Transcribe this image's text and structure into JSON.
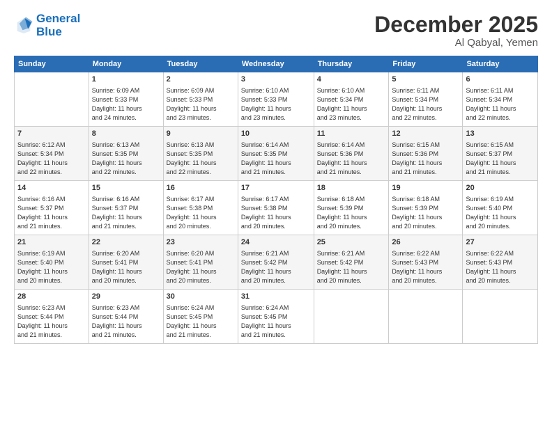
{
  "logo": {
    "line1": "General",
    "line2": "Blue"
  },
  "title": "December 2025",
  "subtitle": "Al Qabyal, Yemen",
  "header_days": [
    "Sunday",
    "Monday",
    "Tuesday",
    "Wednesday",
    "Thursday",
    "Friday",
    "Saturday"
  ],
  "weeks": [
    [
      {
        "day": "",
        "info": ""
      },
      {
        "day": "1",
        "info": "Sunrise: 6:09 AM\nSunset: 5:33 PM\nDaylight: 11 hours\nand 24 minutes."
      },
      {
        "day": "2",
        "info": "Sunrise: 6:09 AM\nSunset: 5:33 PM\nDaylight: 11 hours\nand 23 minutes."
      },
      {
        "day": "3",
        "info": "Sunrise: 6:10 AM\nSunset: 5:33 PM\nDaylight: 11 hours\nand 23 minutes."
      },
      {
        "day": "4",
        "info": "Sunrise: 6:10 AM\nSunset: 5:34 PM\nDaylight: 11 hours\nand 23 minutes."
      },
      {
        "day": "5",
        "info": "Sunrise: 6:11 AM\nSunset: 5:34 PM\nDaylight: 11 hours\nand 22 minutes."
      },
      {
        "day": "6",
        "info": "Sunrise: 6:11 AM\nSunset: 5:34 PM\nDaylight: 11 hours\nand 22 minutes."
      }
    ],
    [
      {
        "day": "7",
        "info": "Sunrise: 6:12 AM\nSunset: 5:34 PM\nDaylight: 11 hours\nand 22 minutes."
      },
      {
        "day": "8",
        "info": "Sunrise: 6:13 AM\nSunset: 5:35 PM\nDaylight: 11 hours\nand 22 minutes."
      },
      {
        "day": "9",
        "info": "Sunrise: 6:13 AM\nSunset: 5:35 PM\nDaylight: 11 hours\nand 22 minutes."
      },
      {
        "day": "10",
        "info": "Sunrise: 6:14 AM\nSunset: 5:35 PM\nDaylight: 11 hours\nand 21 minutes."
      },
      {
        "day": "11",
        "info": "Sunrise: 6:14 AM\nSunset: 5:36 PM\nDaylight: 11 hours\nand 21 minutes."
      },
      {
        "day": "12",
        "info": "Sunrise: 6:15 AM\nSunset: 5:36 PM\nDaylight: 11 hours\nand 21 minutes."
      },
      {
        "day": "13",
        "info": "Sunrise: 6:15 AM\nSunset: 5:37 PM\nDaylight: 11 hours\nand 21 minutes."
      }
    ],
    [
      {
        "day": "14",
        "info": "Sunrise: 6:16 AM\nSunset: 5:37 PM\nDaylight: 11 hours\nand 21 minutes."
      },
      {
        "day": "15",
        "info": "Sunrise: 6:16 AM\nSunset: 5:37 PM\nDaylight: 11 hours\nand 21 minutes."
      },
      {
        "day": "16",
        "info": "Sunrise: 6:17 AM\nSunset: 5:38 PM\nDaylight: 11 hours\nand 20 minutes."
      },
      {
        "day": "17",
        "info": "Sunrise: 6:17 AM\nSunset: 5:38 PM\nDaylight: 11 hours\nand 20 minutes."
      },
      {
        "day": "18",
        "info": "Sunrise: 6:18 AM\nSunset: 5:39 PM\nDaylight: 11 hours\nand 20 minutes."
      },
      {
        "day": "19",
        "info": "Sunrise: 6:18 AM\nSunset: 5:39 PM\nDaylight: 11 hours\nand 20 minutes."
      },
      {
        "day": "20",
        "info": "Sunrise: 6:19 AM\nSunset: 5:40 PM\nDaylight: 11 hours\nand 20 minutes."
      }
    ],
    [
      {
        "day": "21",
        "info": "Sunrise: 6:19 AM\nSunset: 5:40 PM\nDaylight: 11 hours\nand 20 minutes."
      },
      {
        "day": "22",
        "info": "Sunrise: 6:20 AM\nSunset: 5:41 PM\nDaylight: 11 hours\nand 20 minutes."
      },
      {
        "day": "23",
        "info": "Sunrise: 6:20 AM\nSunset: 5:41 PM\nDaylight: 11 hours\nand 20 minutes."
      },
      {
        "day": "24",
        "info": "Sunrise: 6:21 AM\nSunset: 5:42 PM\nDaylight: 11 hours\nand 20 minutes."
      },
      {
        "day": "25",
        "info": "Sunrise: 6:21 AM\nSunset: 5:42 PM\nDaylight: 11 hours\nand 20 minutes."
      },
      {
        "day": "26",
        "info": "Sunrise: 6:22 AM\nSunset: 5:43 PM\nDaylight: 11 hours\nand 20 minutes."
      },
      {
        "day": "27",
        "info": "Sunrise: 6:22 AM\nSunset: 5:43 PM\nDaylight: 11 hours\nand 20 minutes."
      }
    ],
    [
      {
        "day": "28",
        "info": "Sunrise: 6:23 AM\nSunset: 5:44 PM\nDaylight: 11 hours\nand 21 minutes."
      },
      {
        "day": "29",
        "info": "Sunrise: 6:23 AM\nSunset: 5:44 PM\nDaylight: 11 hours\nand 21 minutes."
      },
      {
        "day": "30",
        "info": "Sunrise: 6:24 AM\nSunset: 5:45 PM\nDaylight: 11 hours\nand 21 minutes."
      },
      {
        "day": "31",
        "info": "Sunrise: 6:24 AM\nSunset: 5:45 PM\nDaylight: 11 hours\nand 21 minutes."
      },
      {
        "day": "",
        "info": ""
      },
      {
        "day": "",
        "info": ""
      },
      {
        "day": "",
        "info": ""
      }
    ]
  ]
}
